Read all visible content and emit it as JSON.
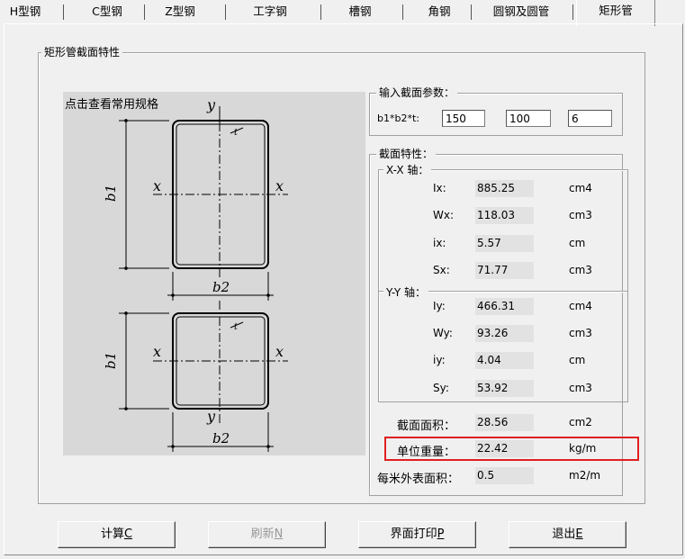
{
  "tabs": [
    "H型钢",
    "C型钢",
    "Z型钢",
    "工字钢",
    "槽钢",
    "角钢",
    "圆钢及圆管",
    "矩形管"
  ],
  "section_group": {
    "title": "矩形管截面特性"
  },
  "image_panel": {
    "caption": "点击查看常用规格",
    "axis_labels": {
      "y": "y",
      "x": "x",
      "b1": "b1",
      "b2": "b2",
      "t": "t"
    }
  },
  "input_group": {
    "title": "输入截面参数：",
    "param_label": "b1*b2*t:",
    "b1": "150",
    "b2": "100",
    "t": "6"
  },
  "props_group": {
    "title": "截面特性：",
    "xx_title": "X-X 轴：",
    "yy_title": "Y-Y 轴：",
    "xx": [
      {
        "label": "Ix:",
        "value": "885.25",
        "unit": "cm4"
      },
      {
        "label": "Wx:",
        "value": "118.03",
        "unit": "cm3"
      },
      {
        "label": "ix:",
        "value": "5.57",
        "unit": "cm"
      },
      {
        "label": "Sx:",
        "value": "71.77",
        "unit": "cm3"
      }
    ],
    "yy": [
      {
        "label": "Iy:",
        "value": "466.31",
        "unit": "cm4"
      },
      {
        "label": "Wy:",
        "value": "93.26",
        "unit": "cm3"
      },
      {
        "label": "iy:",
        "value": "4.04",
        "unit": "cm"
      },
      {
        "label": "Sy:",
        "value": "53.92",
        "unit": "cm3"
      }
    ]
  },
  "summary": {
    "area": {
      "label": "截面面积：",
      "value": "28.56",
      "unit": "cm2"
    },
    "weight": {
      "label": "单位重量：",
      "value": "22.42",
      "unit": "kg/m"
    },
    "surface": {
      "label": "每米外表面积：",
      "value": "0.5",
      "unit": "m2/m"
    }
  },
  "buttons": {
    "calc": {
      "text": "计算",
      "key": "C"
    },
    "refresh": {
      "text": "刷新",
      "key": "N"
    },
    "print": {
      "text": "界面打印",
      "key": "P"
    },
    "exit": {
      "text": "退出",
      "key": "E"
    }
  },
  "highlight_color": "#e02020"
}
